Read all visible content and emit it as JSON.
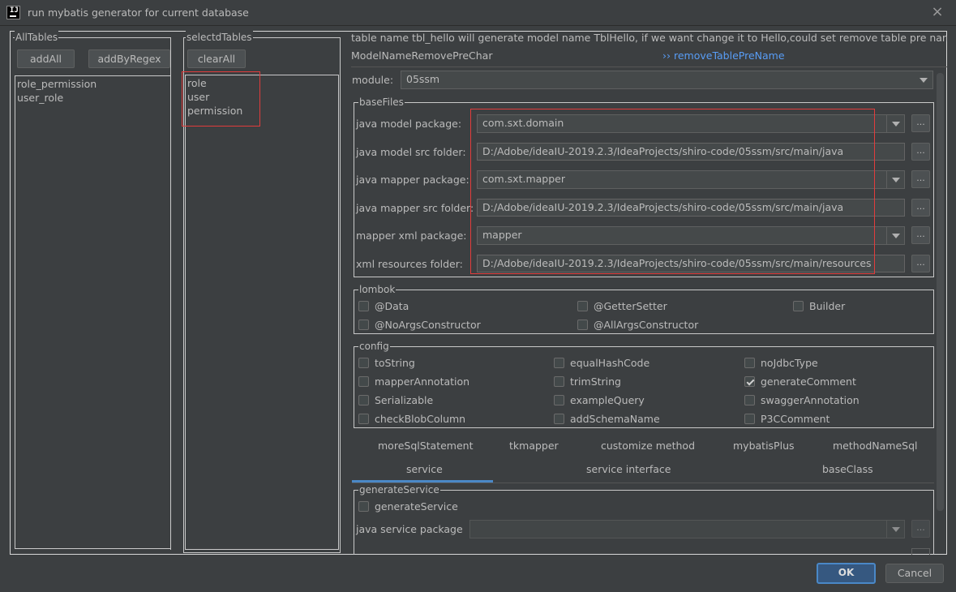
{
  "window": {
    "title": "run mybatis generator for current database",
    "app_icon": "intellij-icon",
    "close": "×"
  },
  "all_tables": {
    "legend": "AllTables",
    "add_all": "addAll",
    "add_by_regex": "addByRegex",
    "items": [
      "role_permission",
      "user_role"
    ]
  },
  "selected_tables": {
    "legend": "selectdTables",
    "clear_all": "clearAll",
    "items": [
      "role",
      "user",
      "permission"
    ]
  },
  "info": {
    "line1": "table name tbl_hello will generate model name TblHello, if we want change it to Hello,could set remove table pre name to tbl_",
    "line2": "ModelNameRemovePreChar",
    "link_prefix": "››",
    "link": "removeTablePreName"
  },
  "module": {
    "label": "module:",
    "value": "05ssm"
  },
  "base_files": {
    "legend": "baseFiles",
    "rows": [
      {
        "label": "java model package:",
        "value": "com.sxt.domain",
        "type": "combo"
      },
      {
        "label": "java model src folder:",
        "value": "D:/Adobe/ideaIU-2019.2.3/IdeaProjects/shiro-code/05ssm/src/main/java",
        "type": "text"
      },
      {
        "label": "java mapper package:",
        "value": "com.sxt.mapper",
        "type": "combo"
      },
      {
        "label": "java mapper src folder:",
        "value": "D:/Adobe/ideaIU-2019.2.3/IdeaProjects/shiro-code/05ssm/src/main/java",
        "type": "text"
      },
      {
        "label": "mapper xml package:",
        "value": "mapper",
        "type": "combo"
      },
      {
        "label": "xml resources folder:",
        "value": "D:/Adobe/ideaIU-2019.2.3/IdeaProjects/shiro-code/05ssm/src/main/resources",
        "type": "text"
      }
    ],
    "browse": "..."
  },
  "lombok": {
    "legend": "lombok",
    "options": [
      {
        "label": "@Data",
        "checked": false
      },
      {
        "label": "@GetterSetter",
        "checked": false
      },
      {
        "label": "Builder",
        "checked": false
      },
      {
        "label": "@NoArgsConstructor",
        "checked": false
      },
      {
        "label": "@AllArgsConstructor",
        "checked": false
      }
    ]
  },
  "config": {
    "legend": "config",
    "options": [
      {
        "label": "toString",
        "checked": false
      },
      {
        "label": "equalHashCode",
        "checked": false
      },
      {
        "label": "noJdbcType",
        "checked": false
      },
      {
        "label": "mapperAnnotation",
        "checked": false
      },
      {
        "label": "trimString",
        "checked": false
      },
      {
        "label": "generateComment",
        "checked": true
      },
      {
        "label": "Serializable",
        "checked": false
      },
      {
        "label": "exampleQuery",
        "checked": false
      },
      {
        "label": "swaggerAnnotation",
        "checked": false
      },
      {
        "label": "checkBlobColumn",
        "checked": false
      },
      {
        "label": "addSchemaName",
        "checked": false
      },
      {
        "label": "P3CComment",
        "checked": false
      }
    ]
  },
  "tabs": {
    "row1": [
      "moreSqlStatement",
      "tkmapper",
      "customize method",
      "mybatisPlus",
      "methodNameSql"
    ],
    "row2": [
      "service",
      "service interface",
      "baseClass"
    ],
    "active": "service"
  },
  "generate_service": {
    "legend": "generateService",
    "checkbox": {
      "label": "generateService",
      "checked": false
    },
    "package_label": "java service package",
    "package_value": "",
    "browse": "..."
  },
  "footer": {
    "ok": "OK",
    "cancel": "Cancel"
  },
  "colors": {
    "accent": "#589df6",
    "highlight_border": "#e23c3c",
    "ok_border": "#4a88c7",
    "background": "#3c3f41"
  }
}
